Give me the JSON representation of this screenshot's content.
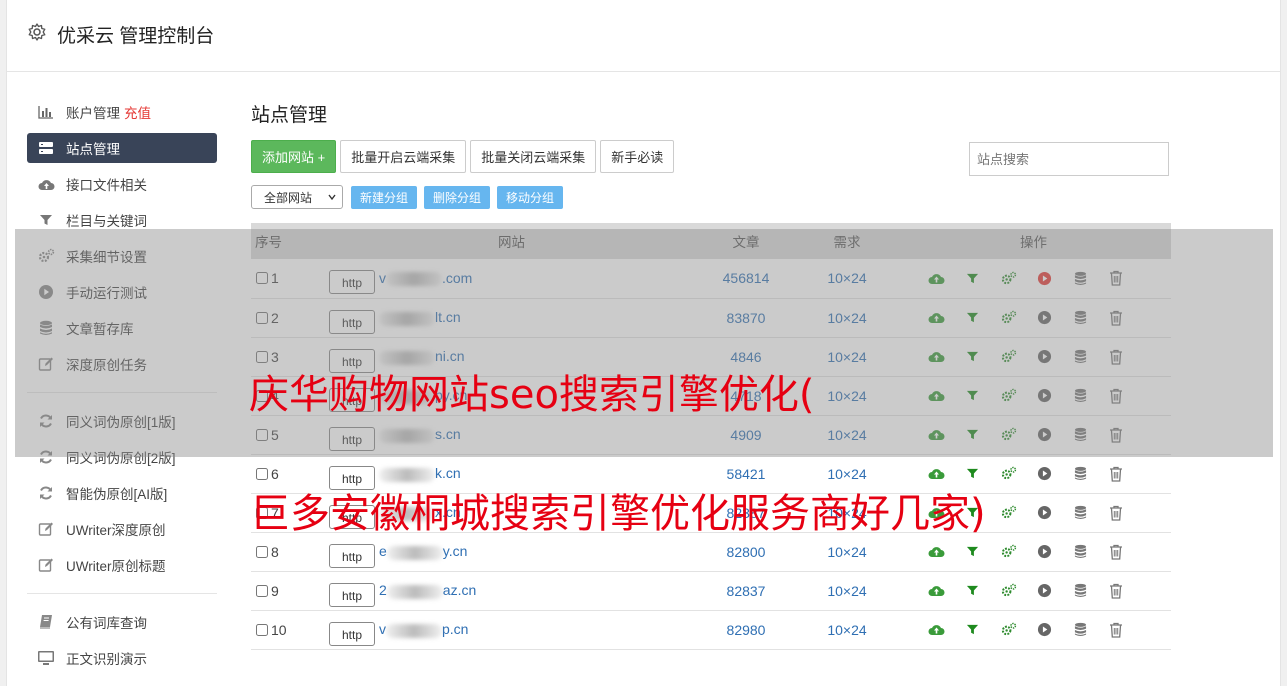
{
  "app": {
    "title": "优采云 管理控制台"
  },
  "sidebar": {
    "group1": [
      {
        "label": "账户管理",
        "extra": "充值",
        "icon": "bar-chart-icon"
      },
      {
        "label": "站点管理",
        "icon": "server-icon",
        "active": true
      },
      {
        "label": "接口文件相关",
        "icon": "cloud-upload-icon"
      },
      {
        "label": "栏目与关键词",
        "icon": "filter-icon"
      },
      {
        "label": "采集细节设置",
        "icon": "gears-icon"
      },
      {
        "label": "手动运行测试",
        "icon": "play-circle-icon"
      },
      {
        "label": "文章暂存库",
        "icon": "database-icon"
      },
      {
        "label": "深度原创任务",
        "icon": "edit-icon"
      }
    ],
    "group2": [
      {
        "label": "同义词伪原创[1版]",
        "icon": "refresh-icon"
      },
      {
        "label": "同义词伪原创[2版]",
        "icon": "refresh-icon"
      },
      {
        "label": "智能伪原创[AI版]",
        "icon": "refresh-icon"
      },
      {
        "label": "UWriter深度原创",
        "icon": "edit-icon"
      },
      {
        "label": "UWriter原创标题",
        "icon": "edit-icon"
      }
    ],
    "group3": [
      {
        "label": "公有词库查询",
        "icon": "book-icon"
      },
      {
        "label": "正文识别演示",
        "icon": "monitor-icon"
      }
    ]
  },
  "main": {
    "page_title": "站点管理",
    "add_site": "添加网站 +",
    "batch_open": "批量开启云端采集",
    "batch_close": "批量关闭云端采集",
    "newbie": "新手必读",
    "search_placeholder": "站点搜索",
    "group_select": "全部网站",
    "new_group": "新建分组",
    "delete_group": "删除分组",
    "move_group": "移动分组"
  },
  "table": {
    "headers": {
      "num": "序号",
      "site": "网站",
      "articles": "文章",
      "demand": "需求",
      "ops": "操作"
    },
    "rows": [
      {
        "num": "1",
        "prefix": "v",
        "suffix": ".com",
        "articles": "456814",
        "demand": "10×24",
        "run_red": true
      },
      {
        "num": "2",
        "prefix": "",
        "suffix": "lt.cn",
        "articles": "83870",
        "demand": "10×24",
        "run_red": false
      },
      {
        "num": "3",
        "prefix": "",
        "suffix": "ni.cn",
        "articles": "4846",
        "demand": "10×24",
        "run_red": false
      },
      {
        "num": "4",
        "prefix": "",
        "suffix": "py.cn",
        "articles": "4718",
        "demand": "10×24",
        "run_red": false
      },
      {
        "num": "5",
        "prefix": "",
        "suffix": "s.cn",
        "articles": "4909",
        "demand": "10×24",
        "run_red": false
      },
      {
        "num": "6",
        "prefix": "",
        "suffix": "k.cn",
        "articles": "58421",
        "demand": "10×24",
        "run_red": false
      },
      {
        "num": "7",
        "prefix": "",
        "suffix": "x.cn",
        "articles": "82387",
        "demand": "10×24",
        "run_red": false
      },
      {
        "num": "8",
        "prefix": "e",
        "suffix": "y.cn",
        "articles": "82800",
        "demand": "10×24",
        "run_red": false
      },
      {
        "num": "9",
        "prefix": "2",
        "suffix": "az.cn",
        "articles": "82837",
        "demand": "10×24",
        "run_red": false
      },
      {
        "num": "10",
        "prefix": "v",
        "suffix": "p.cn",
        "articles": "82980",
        "demand": "10×24",
        "run_red": false
      }
    ],
    "http_label": "http"
  },
  "watermark": {
    "line1": "庆华购物网站seo搜索引擎优化(",
    "line2": "巨多安徽桐城搜索引擎优化服务商好几家)"
  },
  "colors": {
    "accent_green": "#5cb85c",
    "sidebar_active": "#394458",
    "link_blue": "#2f6fb3",
    "run_red": "#e53935",
    "watermark_red": "#e60012"
  }
}
